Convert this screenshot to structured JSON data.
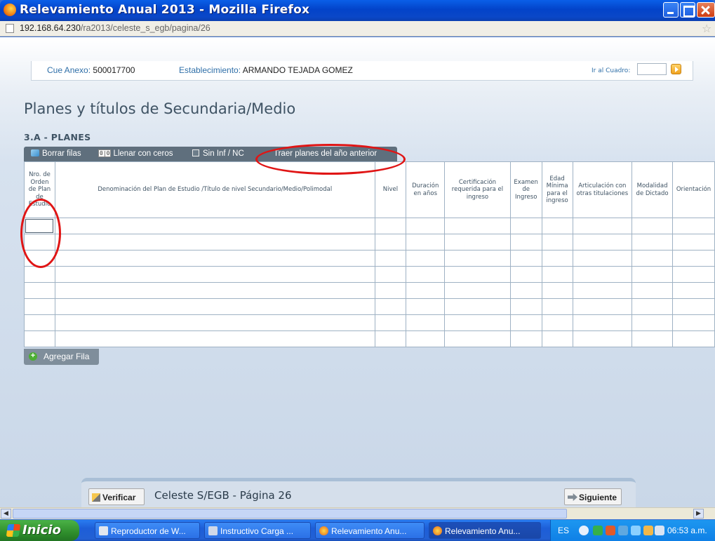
{
  "window": {
    "title": "Relevamiento Anual 2013 - Mozilla Firefox"
  },
  "browser": {
    "url_host": "192.168.64.230",
    "url_path": "/ra2013/celeste_s_egb/pagina/26"
  },
  "header": {
    "cue_label": "Cue Anexo:",
    "cue_value": "500017700",
    "est_label": "Establecimiento:",
    "est_value": "ARMANDO TEJADA GOMEZ",
    "ir_label": "Ir al Cuadro:"
  },
  "page": {
    "title": "Planes y títulos de Secundaria/Medio",
    "section": "3.A - PLANES"
  },
  "toolbar": {
    "borrar": "Borrar filas",
    "zero_icon": "0|0",
    "llenar": "Llenar con ceros",
    "sininf": "Sin Inf / NC",
    "traer": "Traer planes del año anterior"
  },
  "table": {
    "columns": [
      "Nro. de Orden de Plan de Estudio",
      "Denominación del Plan de Estudio /Título de nivel Secundario/Medio/Polimodal",
      "Nivel",
      "Duración en años",
      "Certificación requerida para el ingreso",
      "Examen de Ingreso",
      "Edad Mínima para el ingreso",
      "Articulación con otras titulaciones",
      "Modalidad de Dictado",
      "Orientación"
    ],
    "row_count": 8
  },
  "actions": {
    "agregar": "Agregar Fila",
    "verificar": "Verificar",
    "siguiente": "Siguiente"
  },
  "footer": {
    "title": "Celeste S/EGB - Página 26"
  },
  "taskbar": {
    "start": "Inicio",
    "tasks": [
      "Reproductor de W...",
      "Instructivo Carga ...",
      "Relevamiento Anu...",
      "Relevamiento Anu..."
    ],
    "lang": "ES",
    "clock": "06:53 a.m."
  },
  "colors": {
    "annotation": "#e01515",
    "toolbar": "#5f6f7d",
    "title_text": "#3f5364",
    "link_blue": "#2f6fa8"
  }
}
